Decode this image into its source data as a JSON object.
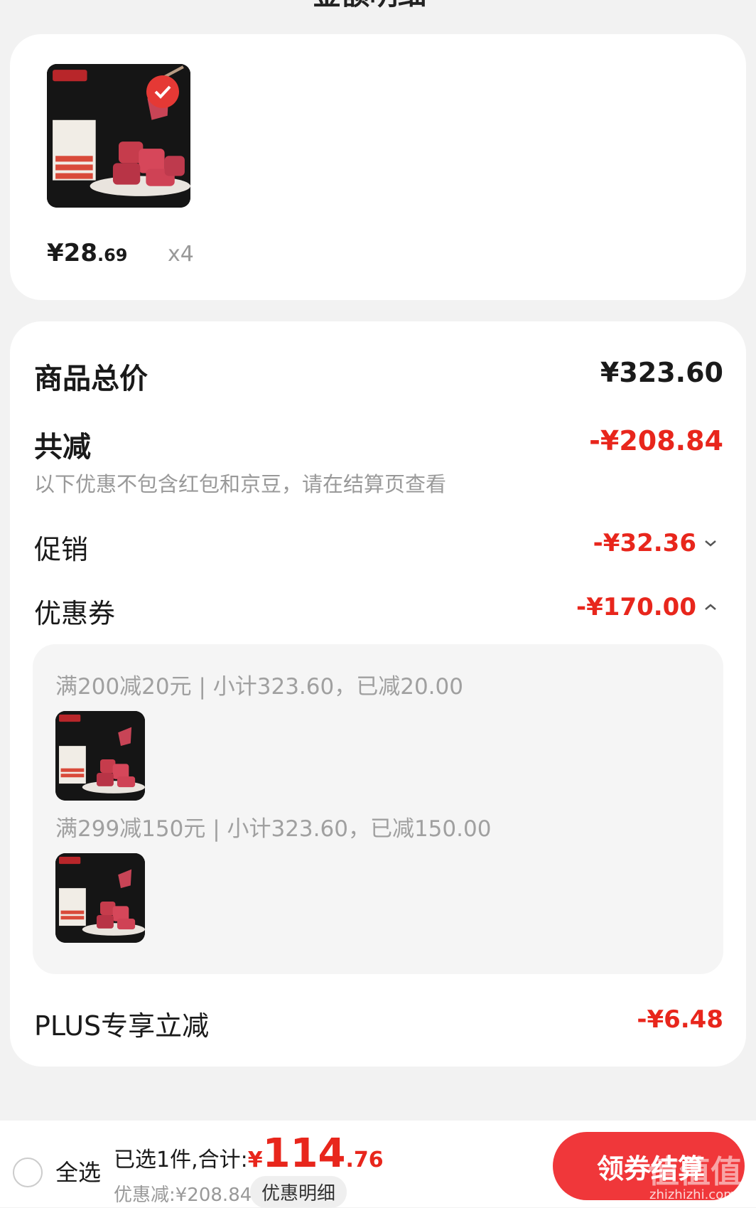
{
  "header": {
    "title": "金额明细"
  },
  "product": {
    "price_int": "¥28",
    "price_dec": ".69",
    "quantity": "x4",
    "checked": true
  },
  "totals": {
    "goods_total_label": "商品总价",
    "goods_total_value": "¥323.60",
    "reduction_label": "共减",
    "reduction_value": "-¥208.84",
    "reduction_note": "以下优惠不包含红包和京豆，请在结算页查看",
    "promo_label": "促销",
    "promo_value": "-¥32.36",
    "coupon_label": "优惠券",
    "coupon_value": "-¥170.00",
    "plus_label": "PLUS专享立减",
    "plus_value": "-¥6.48"
  },
  "coupons": [
    {
      "text": "满200减20元 | 小计323.60，已减20.00"
    },
    {
      "text": "满299减150元 | 小计323.60，已减150.00"
    }
  ],
  "bottom_bar": {
    "select_all": "全选",
    "selected_prefix": "已选1件,合计:",
    "total_yen": "¥",
    "total_int": "114",
    "total_dec": ".76",
    "discount_text": "优惠减:¥208.84",
    "detail_button": "优惠明细",
    "cta_label": "领券结算",
    "watermark": "值值值",
    "watermark_url": "zhizhizhi.com"
  },
  "colors": {
    "accent": "#e8261c",
    "cta": "#f0373a",
    "card_bg": "#ffffff",
    "page_bg": "#f2f2f2"
  }
}
